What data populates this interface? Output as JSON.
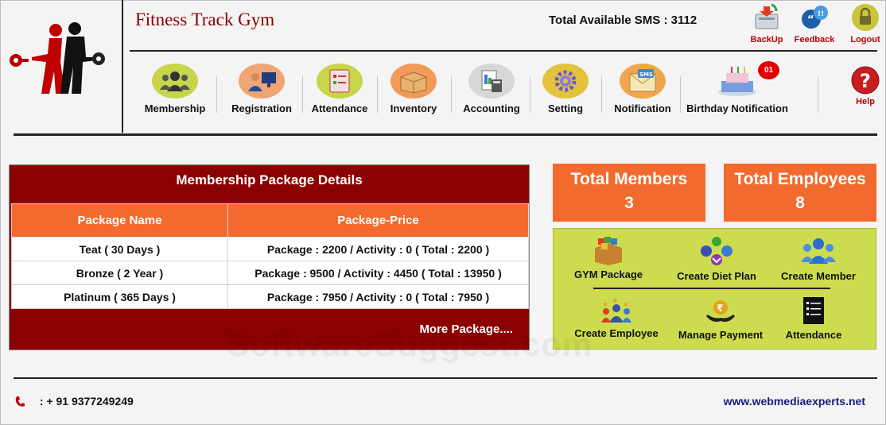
{
  "header": {
    "app_title": "Fitness Track Gym",
    "sms_label": "Total Available SMS : 3112"
  },
  "top_actions": [
    {
      "label": "BackUp",
      "icon": "backup-icon"
    },
    {
      "label": "Feedback",
      "icon": "feedback-icon"
    },
    {
      "label": "Logout",
      "icon": "logout-icon"
    }
  ],
  "nav": [
    {
      "label": "Membership",
      "icon": "membership-icon"
    },
    {
      "label": "Registration",
      "icon": "registration-icon"
    },
    {
      "label": "Attendance",
      "icon": "attendance-icon"
    },
    {
      "label": "Inventory",
      "icon": "inventory-icon"
    },
    {
      "label": "Accounting",
      "icon": "accounting-icon"
    },
    {
      "label": "Setting",
      "icon": "setting-icon"
    },
    {
      "label": "Notification",
      "icon": "notification-icon"
    },
    {
      "label": "Birthday Notification",
      "icon": "birthday-cake-icon",
      "badge": "01"
    }
  ],
  "help": {
    "label": "Help",
    "icon": "help-icon"
  },
  "package_panel": {
    "title": "Membership Package Details",
    "columns": [
      "Package Name",
      "Package-Price"
    ],
    "rows": [
      [
        "Teat ( 30 Days )",
        "Package : 2200 / Activity : 0 ( Total : 2200 )"
      ],
      [
        "Bronze ( 2 Year )",
        "Package : 9500 / Activity : 4450 ( Total : 13950 )"
      ],
      [
        "Platinum ( 365 Days )",
        "Package : 7950 / Activity : 0 ( Total : 7950 )"
      ]
    ],
    "more_label": "More Package...."
  },
  "stats": {
    "members": {
      "label": "Total Members",
      "value": "3"
    },
    "employees": {
      "label": "Total Employees",
      "value": "8"
    }
  },
  "quick_actions": [
    {
      "label": "GYM Package",
      "icon": "gym-package-icon"
    },
    {
      "label": "Create Diet Plan",
      "icon": "diet-plan-icon"
    },
    {
      "label": "Create Member",
      "icon": "create-member-icon"
    },
    {
      "label": "Create Employee",
      "icon": "create-employee-icon"
    },
    {
      "label": "Manage Payment",
      "icon": "manage-payment-icon"
    },
    {
      "label": "Attendance",
      "icon": "attendance-sheet-icon"
    }
  ],
  "footer": {
    "phone": ": + 91 9377249249",
    "website": "www.webmediaexperts.net"
  },
  "watermark": "SoftwareSuggest.com",
  "colors": {
    "brand_dark_red": "#8b0000",
    "accent_orange": "#f26a2e",
    "quick_panel": "#cddc4e"
  }
}
